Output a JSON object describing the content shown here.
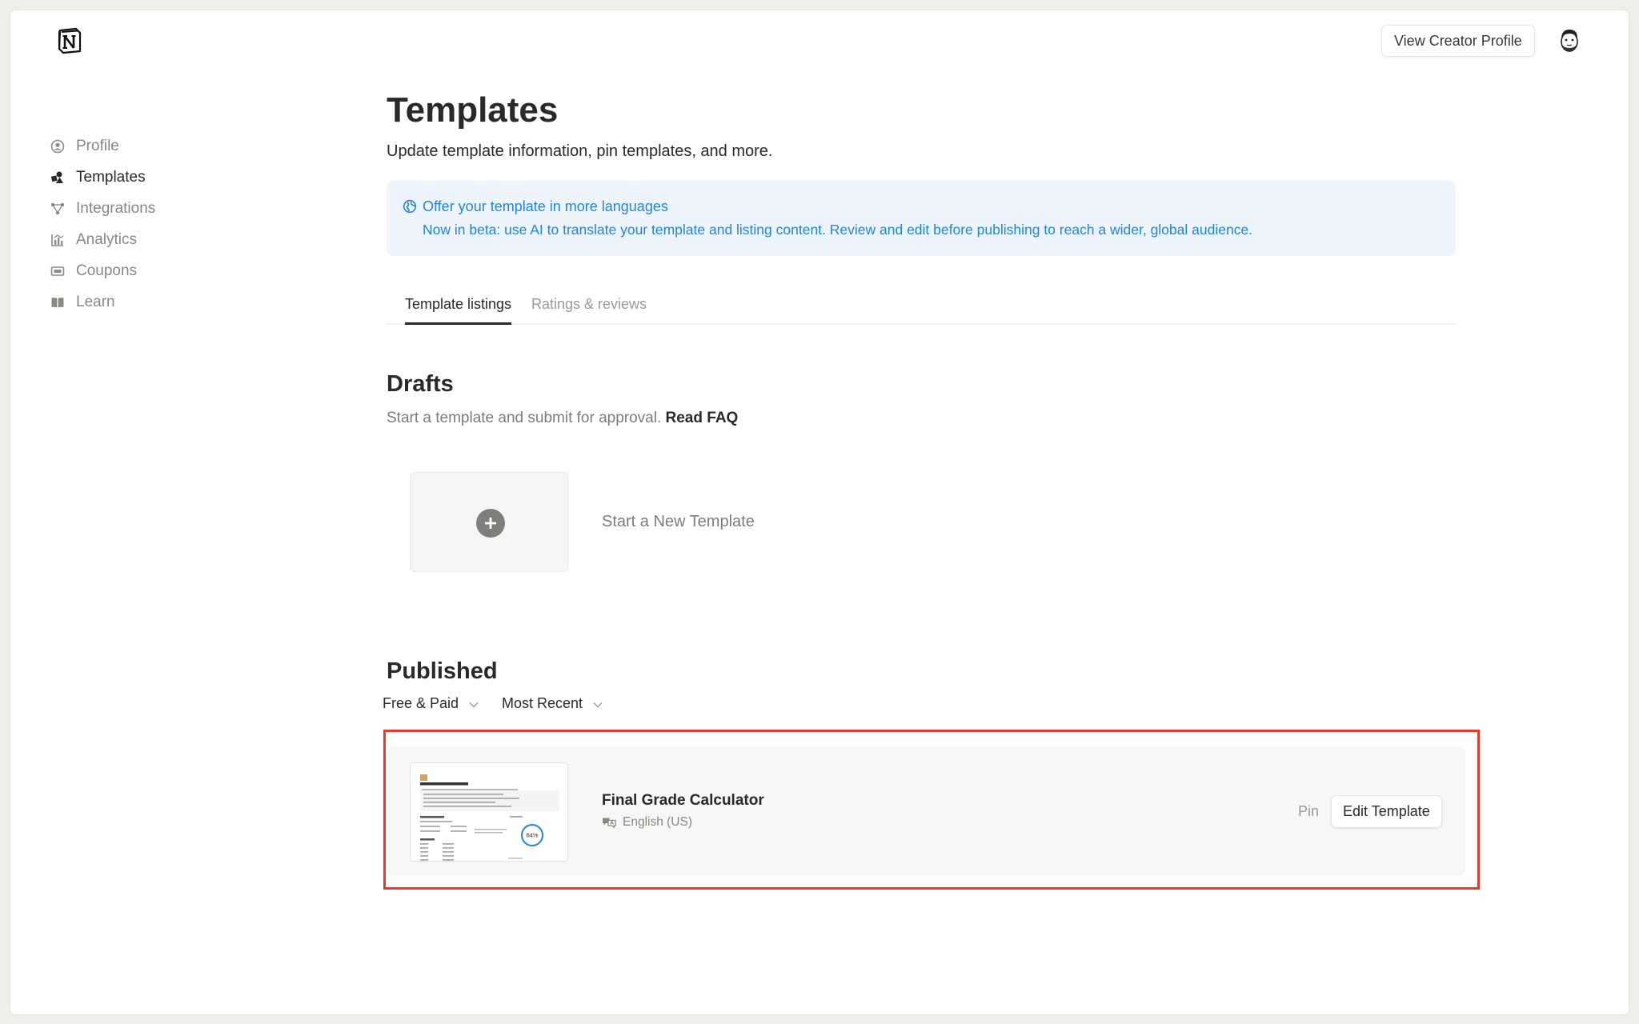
{
  "header": {
    "logo_icon": "notion-logo",
    "view_creator_profile": "View Creator Profile",
    "avatar_icon": "user-avatar"
  },
  "sidebar": {
    "items": [
      {
        "label": "Profile",
        "icon": "profile-icon",
        "active": false
      },
      {
        "label": "Templates",
        "icon": "templates-icon",
        "active": true
      },
      {
        "label": "Integrations",
        "icon": "integrations-icon",
        "active": false
      },
      {
        "label": "Analytics",
        "icon": "analytics-icon",
        "active": false
      },
      {
        "label": "Coupons",
        "icon": "coupons-icon",
        "active": false
      },
      {
        "label": "Learn",
        "icon": "learn-icon",
        "active": false
      }
    ]
  },
  "page": {
    "title": "Templates",
    "subtitle": "Update template information, pin templates, and more."
  },
  "banner": {
    "icon": "globe-icon",
    "title": "Offer your template in more languages",
    "text": "Now in beta: use AI to translate your template and listing content. Review and edit before publishing to reach a wider, global audience.",
    "color": "#2383e2"
  },
  "tabs": [
    {
      "label": "Template listings",
      "active": true
    },
    {
      "label": "Ratings & reviews",
      "active": false
    }
  ],
  "drafts": {
    "heading": "Drafts",
    "sub_text": "Start a template and submit for approval.",
    "faq_link": "Read FAQ",
    "new_template_label": "Start a New Template"
  },
  "published": {
    "heading": "Published",
    "filter_price": "Free & Paid",
    "filter_sort": "Most Recent",
    "templates": [
      {
        "name": "Final Grade Calculator",
        "language": "English (US)",
        "pin_label": "Pin",
        "edit_label": "Edit Template",
        "thumb_title": "Final Grade Calculator",
        "thumb_percent": "64%"
      }
    ]
  },
  "highlight_color": "#e8392c"
}
